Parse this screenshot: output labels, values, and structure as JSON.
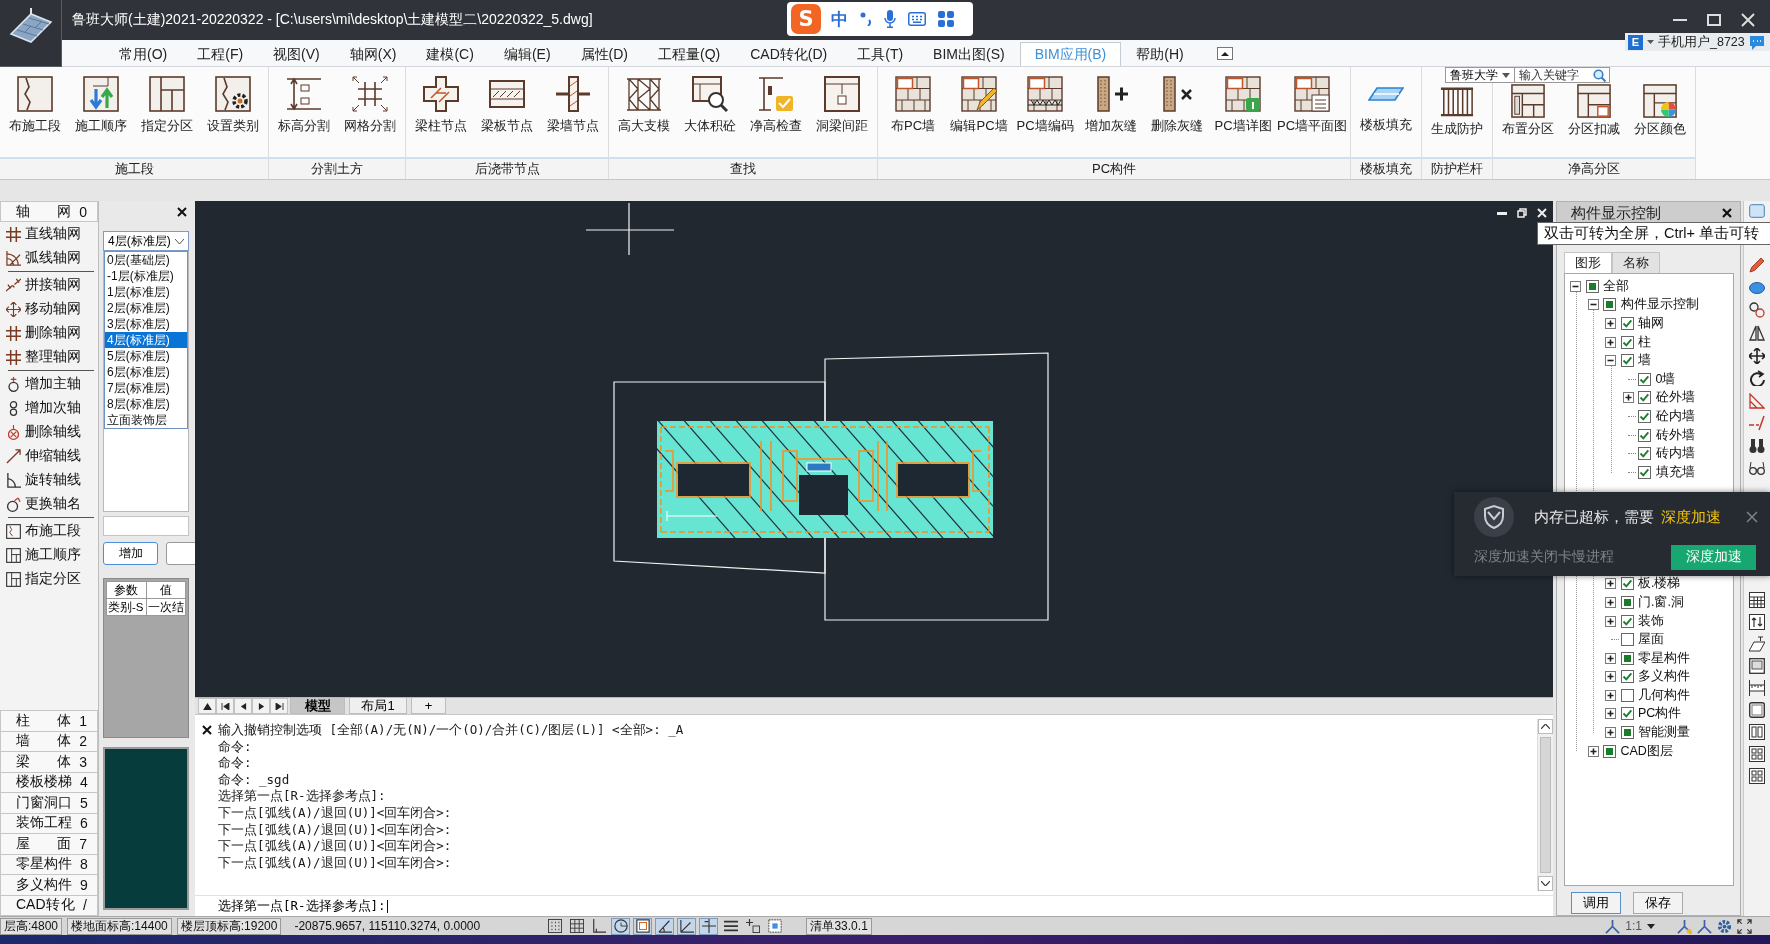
{
  "window": {
    "title": "鲁班大师(土建)2021-20220322 - [C:\\users\\mi\\desktop\\土建模型二\\20220322_5.dwg]"
  },
  "ime_bar": {
    "logo": "S",
    "mode": "中"
  },
  "menu": [
    {
      "label": "常用(O)",
      "selected": false
    },
    {
      "label": "工程(F)",
      "selected": false
    },
    {
      "label": "视图(V)",
      "selected": false
    },
    {
      "label": "轴网(X)",
      "selected": false
    },
    {
      "label": "建模(C)",
      "selected": false
    },
    {
      "label": "编辑(E)",
      "selected": false
    },
    {
      "label": "属性(D)",
      "selected": false
    },
    {
      "label": "工程量(Q)",
      "selected": false
    },
    {
      "label": "CAD转化(D)",
      "selected": false
    },
    {
      "label": "工具(T)",
      "selected": false
    },
    {
      "label": "BIM出图(S)",
      "selected": false
    },
    {
      "label": "BIM应用(B)",
      "selected": true
    },
    {
      "label": "帮助(H)",
      "selected": false
    }
  ],
  "user": {
    "badge": "E",
    "name": "手机用户_8723"
  },
  "ribbon_search": {
    "scope": "鲁班大学",
    "placeholder": "输入关键字"
  },
  "ribbon": [
    {
      "label": "施工段",
      "buttons": [
        "布施工段",
        "施工顺序",
        "指定分区",
        "设置类别"
      ]
    },
    {
      "label": "分割土方",
      "buttons": [
        "标高分割",
        "网格分割"
      ]
    },
    {
      "label": "后浇带节点",
      "buttons": [
        "梁柱节点",
        "梁板节点",
        "梁墙节点"
      ]
    },
    {
      "label": "查找",
      "buttons": [
        "高大支模",
        "大体积砼",
        "净高检查",
        "洞梁间距"
      ]
    },
    {
      "label": "PC构件",
      "buttons": [
        "布PC墙",
        "编辑PC墙",
        "PC墙编码",
        "增加灰缝",
        "删除灰缝",
        "PC墙详图",
        "PC墙平面图"
      ]
    },
    {
      "label": "楼板填充",
      "buttons": [
        "楼板填充"
      ]
    },
    {
      "label": "防护栏杆",
      "buttons": [
        "生成防护"
      ]
    },
    {
      "label": "净高分区",
      "buttons": [
        "布置分区",
        "分区扣减",
        "分区颜色"
      ]
    }
  ],
  "left_toolbar": {
    "header": {
      "label": "轴 网",
      "key": "0"
    },
    "groups": [
      [
        "直线轴网",
        "弧线轴网"
      ],
      [
        "拼接轴网",
        "移动轴网",
        "删除轴网",
        "整理轴网"
      ],
      [
        "增加主轴",
        "增加次轴",
        "删除轴线",
        "伸缩轴线",
        "旋转轴线",
        "更换轴名"
      ],
      [
        "布施工段",
        "施工顺序",
        "指定分区"
      ]
    ],
    "categories": [
      {
        "label": "柱 体",
        "key": "1"
      },
      {
        "label": "墙 体",
        "key": "2"
      },
      {
        "label": "梁 体",
        "key": "3"
      },
      {
        "label": "楼板楼梯",
        "key": "4"
      },
      {
        "label": "门窗洞口",
        "key": "5"
      },
      {
        "label": "装饰工程",
        "key": "6"
      },
      {
        "label": "屋 面",
        "key": "7"
      },
      {
        "label": "零星构件",
        "key": "8"
      },
      {
        "label": "多义构件",
        "key": "9"
      },
      {
        "label": "CAD转化",
        "key": "/"
      }
    ]
  },
  "floor_panel": {
    "combo": {
      "value": "4层(标准层)",
      "open": true
    },
    "floors": [
      {
        "label": "0层(基础层)",
        "selected": false
      },
      {
        "label": "-1层(标准层)",
        "selected": false
      },
      {
        "label": "1层(标准层)",
        "selected": false
      },
      {
        "label": "2层(标准层)",
        "selected": false
      },
      {
        "label": "3层(标准层)",
        "selected": false
      },
      {
        "label": "4层(标准层)",
        "selected": true
      },
      {
        "label": "5层(标准层)",
        "selected": false
      },
      {
        "label": "6层(标准层)",
        "selected": false
      },
      {
        "label": "7层(标准层)",
        "selected": false
      },
      {
        "label": "8层(标准层)",
        "selected": false
      },
      {
        "label": "立面装饰层",
        "selected": false
      }
    ],
    "buttons": [
      "增加"
    ],
    "params": {
      "columns": [
        "参数",
        "值"
      ],
      "rows": [
        [
          "类别-S",
          "一次结"
        ]
      ]
    }
  },
  "canvas": {
    "tabs": [
      {
        "label": "模型",
        "selected": true
      },
      {
        "label": "布局1",
        "selected": false
      },
      {
        "label": "+",
        "selected": false
      }
    ]
  },
  "command": {
    "history": [
      "输入撤销控制选项 [全部(A)/无(N)/一个(O)/合并(C)/图层(L)] <全部>: _A",
      "命令:",
      "命令:",
      "命令: _sgd",
      "选择第一点[R-选择参考点]:",
      "下一点[弧线(A)/退回(U)]<回车闭合>:",
      "下一点[弧线(A)/退回(U)]<回车闭合>:",
      "下一点[弧线(A)/退回(U)]<回车闭合>:",
      "下一点[弧线(A)/退回(U)]<回车闭合>:"
    ],
    "input": "选择第一点[R-选择参考点]:"
  },
  "display_panel": {
    "title": "构件显示控制",
    "tabs": [
      {
        "label": "图形",
        "selected": true
      },
      {
        "label": "名称",
        "selected": false
      }
    ],
    "tree": [
      {
        "label": "全部",
        "checked": false,
        "mixed": true,
        "expandable": true,
        "expanded": true,
        "children": [
          {
            "label": "构件显示控制",
            "checked": false,
            "mixed": true,
            "expandable": true,
            "expanded": true,
            "children": [
              {
                "label": "轴网",
                "checked": true,
                "mixed": false,
                "expandable": true,
                "expanded": false
              },
              {
                "label": "柱",
                "checked": true,
                "mixed": false,
                "expandable": true,
                "expanded": false
              },
              {
                "label": "墙",
                "checked": true,
                "mixed": false,
                "expandable": true,
                "expanded": true,
                "children": [
                  {
                    "label": "0墙",
                    "checked": true,
                    "mixed": false,
                    "expandable": false,
                    "expanded": false
                  },
                  {
                    "label": "砼外墙",
                    "checked": true,
                    "mixed": false,
                    "expandable": true,
                    "expanded": false
                  },
                  {
                    "label": "砼内墙",
                    "checked": true,
                    "mixed": false,
                    "expandable": false,
                    "expanded": false
                  },
                  {
                    "label": "砖外墙",
                    "checked": true,
                    "mixed": false,
                    "expandable": false,
                    "expanded": false
                  },
                  {
                    "label": "砖内墙",
                    "checked": true,
                    "mixed": false,
                    "expandable": false,
                    "expanded": false
                  },
                  {
                    "label": "填充墙",
                    "checked": true,
                    "mixed": false,
                    "expandable": false,
                    "expanded": false
                  }
                ]
              },
              {
                "label": "板.楼梯",
                "checked": true,
                "mixed": false,
                "expandable": true,
                "expanded": false
              },
              {
                "label": "门.窗.洞",
                "checked": false,
                "mixed": true,
                "expandable": true,
                "expanded": false
              },
              {
                "label": "装饰",
                "checked": true,
                "mixed": false,
                "expandable": true,
                "expanded": false
              },
              {
                "label": "屋面",
                "checked": false,
                "mixed": false,
                "expandable": false,
                "expanded": false
              },
              {
                "label": "零星构件",
                "checked": false,
                "mixed": true,
                "expandable": true,
                "expanded": false
              },
              {
                "label": "多义构件",
                "checked": true,
                "mixed": false,
                "expandable": true,
                "expanded": false
              },
              {
                "label": "几何构件",
                "checked": false,
                "mixed": false,
                "expandable": true,
                "expanded": false
              },
              {
                "label": "PC构件",
                "checked": true,
                "mixed": false,
                "expandable": true,
                "expanded": false
              },
              {
                "label": "智能测量",
                "checked": false,
                "mixed": true,
                "expandable": true,
                "expanded": false
              }
            ]
          },
          {
            "label": "CAD图层",
            "checked": false,
            "mixed": true,
            "expandable": true,
            "expanded": false
          }
        ]
      }
    ],
    "buttons": [
      "调用",
      "保存"
    ]
  },
  "tooltip": {
    "text": "双击可转为全屏，Ctrl+ 单击可转"
  },
  "popup": {
    "message": "内存已超标，需要",
    "link": "深度加速",
    "detail": "深度加速关闭卡慢进程",
    "button": "深度加速"
  },
  "status_bar": {
    "fields": [
      "层高:4800",
      "楼地面标高:14400",
      "楼层顶标高:19200"
    ],
    "coordinates": "-20875.9657, 115110.3274, 0.0000",
    "toggles": [
      {
        "on": false
      },
      {
        "on": false
      },
      {
        "on": false
      },
      {
        "on": true
      },
      {
        "on": true
      },
      {
        "on": true
      },
      {
        "on": true
      },
      {
        "on": true
      },
      {
        "on": false
      },
      {
        "on": false
      },
      {
        "on": false
      }
    ],
    "version": "清单33.0.1",
    "scale": "1:1"
  }
}
